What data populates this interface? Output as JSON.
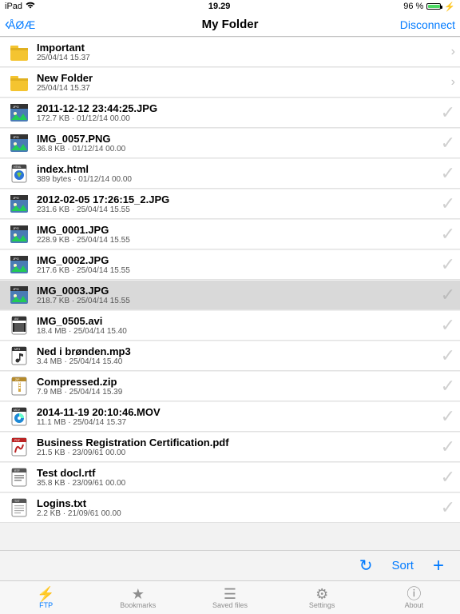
{
  "status": {
    "device": "iPad",
    "wifi": true,
    "time": "19.29",
    "battery_pct": "96 %"
  },
  "nav": {
    "back_label": "ÅØÆ",
    "title": "My Folder",
    "action": "Disconnect"
  },
  "files": [
    {
      "icon": "folder",
      "name": "Important",
      "meta": "25/04/14 15.37",
      "type": "folder"
    },
    {
      "icon": "folder",
      "name": "New Folder",
      "meta": "25/04/14 15.37",
      "type": "folder"
    },
    {
      "icon": "jpg",
      "name": "2011-12-12 23:44:25.JPG",
      "meta": "172.7 KB · 01/12/14 00.00",
      "type": "file"
    },
    {
      "icon": "jpg",
      "name": "IMG_0057.PNG",
      "meta": "36.8 KB · 01/12/14 00.00",
      "type": "file"
    },
    {
      "icon": "html",
      "name": "index.html",
      "meta": "389 bytes · 01/12/14 00.00",
      "type": "file"
    },
    {
      "icon": "jpg",
      "name": "2012-02-05 17:26:15_2.JPG",
      "meta": "231.6 KB · 25/04/14 15.55",
      "type": "file"
    },
    {
      "icon": "jpg",
      "name": "IMG_0001.JPG",
      "meta": "228.9 KB · 25/04/14 15.55",
      "type": "file"
    },
    {
      "icon": "jpg",
      "name": "IMG_0002.JPG",
      "meta": "217.6 KB · 25/04/14 15.55",
      "type": "file"
    },
    {
      "icon": "jpg",
      "name": "IMG_0003.JPG",
      "meta": "218.7 KB · 25/04/14 15.55",
      "type": "file",
      "selected": true
    },
    {
      "icon": "avi",
      "name": "IMG_0505.avi",
      "meta": "18.4 MB · 25/04/14 15.40",
      "type": "file"
    },
    {
      "icon": "mp3",
      "name": "Ned i brønden.mp3",
      "meta": "3.4 MB · 25/04/14 15.40",
      "type": "file"
    },
    {
      "icon": "zip",
      "name": "Compressed.zip",
      "meta": "7.9 MB · 25/04/14 15.39",
      "type": "file"
    },
    {
      "icon": "mov",
      "name": "2014-11-19 20:10:46.MOV",
      "meta": "11.1 MB · 25/04/14 15.37",
      "type": "file"
    },
    {
      "icon": "pdf",
      "name": "Business Registration Certification.pdf",
      "meta": "21.5 KB · 23/09/61 00.00",
      "type": "file"
    },
    {
      "icon": "rtf",
      "name": "Test docl.rtf",
      "meta": "35.8 KB · 23/09/61 00.00",
      "type": "file"
    },
    {
      "icon": "txt",
      "name": "Logins.txt",
      "meta": "2.2 KB · 21/09/61 00.00",
      "type": "file"
    }
  ],
  "toolbar": {
    "refresh": "↻",
    "sort": "Sort",
    "add": "+"
  },
  "tabs": [
    {
      "label": "FTP",
      "active": true,
      "icon": "⚡"
    },
    {
      "label": "Bookmarks",
      "active": false,
      "icon": "★"
    },
    {
      "label": "Saved files",
      "active": false,
      "icon": "☰"
    },
    {
      "label": "Settings",
      "active": false,
      "icon": "⚙"
    },
    {
      "label": "About",
      "active": false,
      "icon": "ⓘ"
    }
  ]
}
